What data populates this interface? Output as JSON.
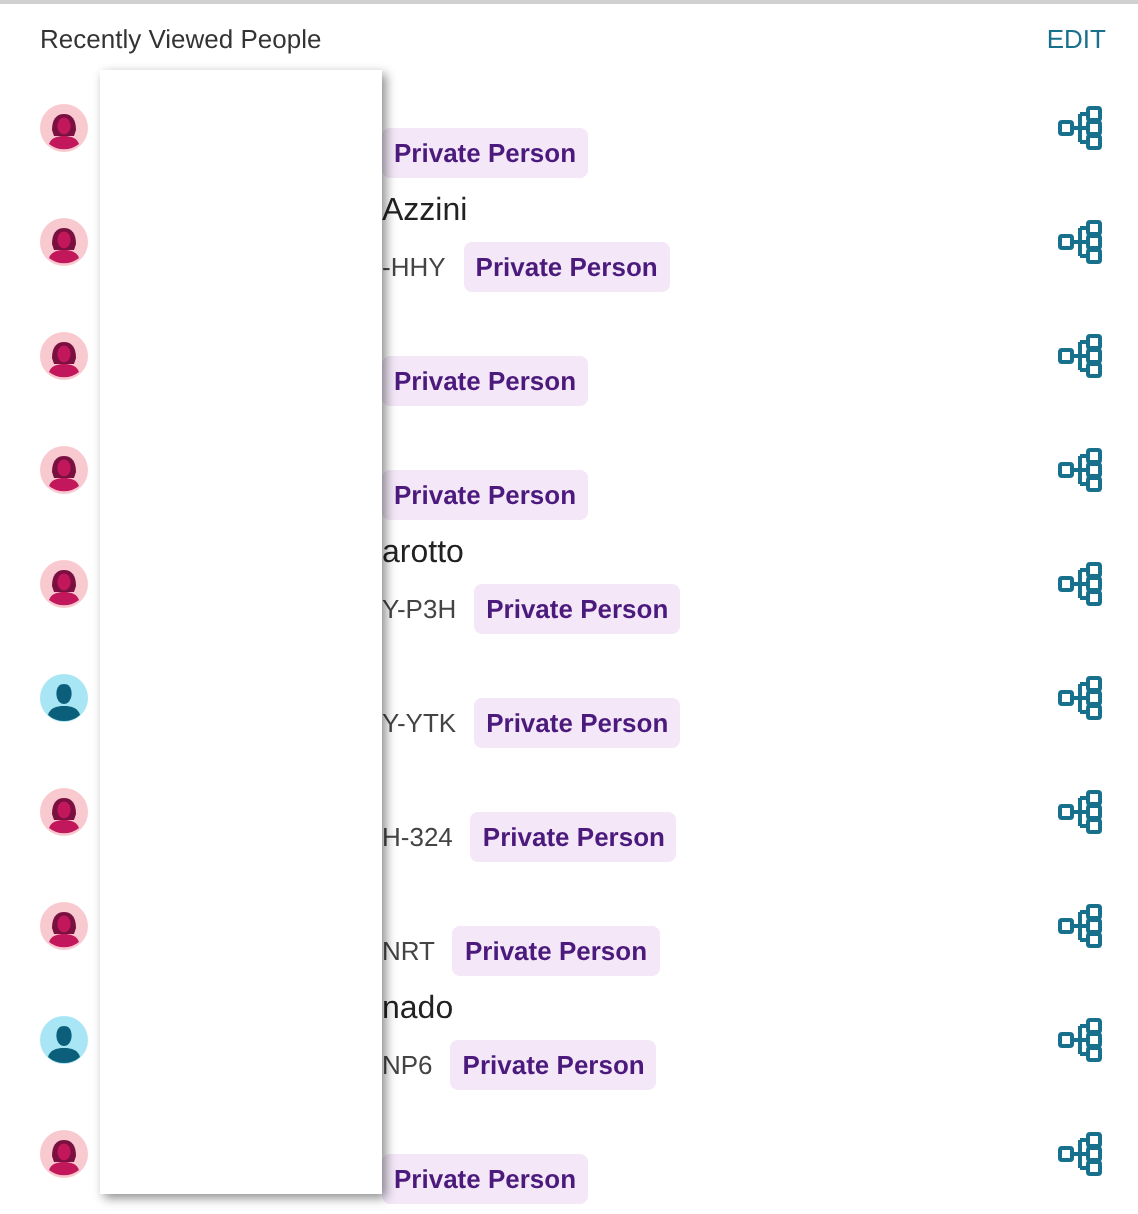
{
  "header": {
    "title": "Recently Viewed People",
    "action": "EDIT"
  },
  "people": [
    {
      "kind": "female",
      "tag": "Private Person"
    },
    {
      "kind": "female",
      "name": "Azzini",
      "id": "-HHY",
      "tag": "Private Person"
    },
    {
      "kind": "female",
      "tag": "Private Person"
    },
    {
      "kind": "female",
      "tag": "Private Person"
    },
    {
      "kind": "female",
      "name": "arotto",
      "id": "Y-P3H",
      "tag": "Private Person"
    },
    {
      "kind": "male",
      "id": "Y-YTK",
      "tag": "Private Person"
    },
    {
      "kind": "female",
      "id": "H-324",
      "tag": "Private Person"
    },
    {
      "kind": "female",
      "id": "NRT",
      "tag": "Private Person"
    },
    {
      "kind": "male",
      "name": "nado",
      "id": "NP6",
      "tag": "Private Person"
    },
    {
      "kind": "female",
      "tag": "Private Person"
    }
  ]
}
